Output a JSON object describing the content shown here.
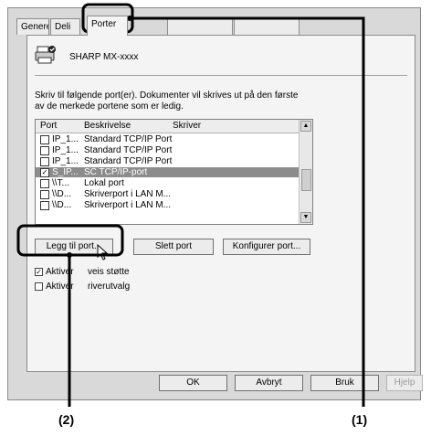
{
  "tabs": [
    "Generelt",
    "Deli",
    "Porter"
  ],
  "printer_name": "SHARP MX-xxxx",
  "description": "Skriv til følgende port(er). Dokumenter vil skrives ut på den første av de merkede portene som er ledig.",
  "list_headers": {
    "port": "Port",
    "desc": "Beskrivelse",
    "printer": "Skriver"
  },
  "ports": [
    {
      "port": "IP_1...",
      "desc": "Standard TCP/IP Port",
      "checked": false
    },
    {
      "port": "IP_1...",
      "desc": "Standard TCP/IP Port",
      "checked": false
    },
    {
      "port": "IP_1...",
      "desc": "Standard TCP/IP Port",
      "checked": false
    },
    {
      "port": "S_IP...",
      "desc": "SC TCP/IP-port",
      "checked": true,
      "selected": true
    },
    {
      "port": "\\\\T...",
      "desc": "Lokal port",
      "checked": false
    },
    {
      "port": "\\\\D...",
      "desc": "Skriverport i LAN M...",
      "checked": false
    },
    {
      "port": "\\\\D...",
      "desc": "Skriverport i LAN M...",
      "checked": false
    }
  ],
  "buttons": {
    "add": "Legg til port...",
    "delete": "Slett port",
    "configure": "Konfigurer port..."
  },
  "options": {
    "bidi": "Aktiver",
    "bidi_tail": "veis støtte",
    "pool": "Aktiver",
    "pool_tail": "riverutvalg"
  },
  "dialog_buttons": {
    "ok": "OK",
    "cancel": "Avbryt",
    "apply": "Bruk",
    "help": "Hjelp"
  },
  "callouts": {
    "one": "(1)",
    "two": "(2)"
  }
}
